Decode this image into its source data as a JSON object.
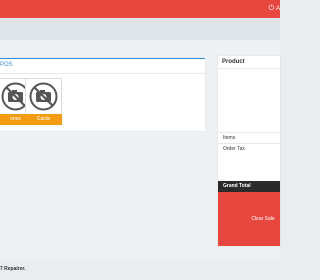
{
  "header": {
    "user_label": "A"
  },
  "pos_panel": {
    "title": "POS",
    "tiles": [
      {
        "label": "ones"
      },
      {
        "label": "Cards"
      }
    ]
  },
  "cart": {
    "header": "Product",
    "items_label": "Items",
    "order_tax_label": "Order Tax",
    "grand_total_label": "Grand Total",
    "clear_sale_label": "Clear Sale"
  },
  "footer": {
    "text": "7 Repairer."
  },
  "colors": {
    "header": "#e8473f",
    "accent_blue": "#3b8fd1",
    "tile_label": "#f39c12",
    "grand_total_bg": "#2b2b2b",
    "clear_sale_bg": "#e8473f"
  }
}
